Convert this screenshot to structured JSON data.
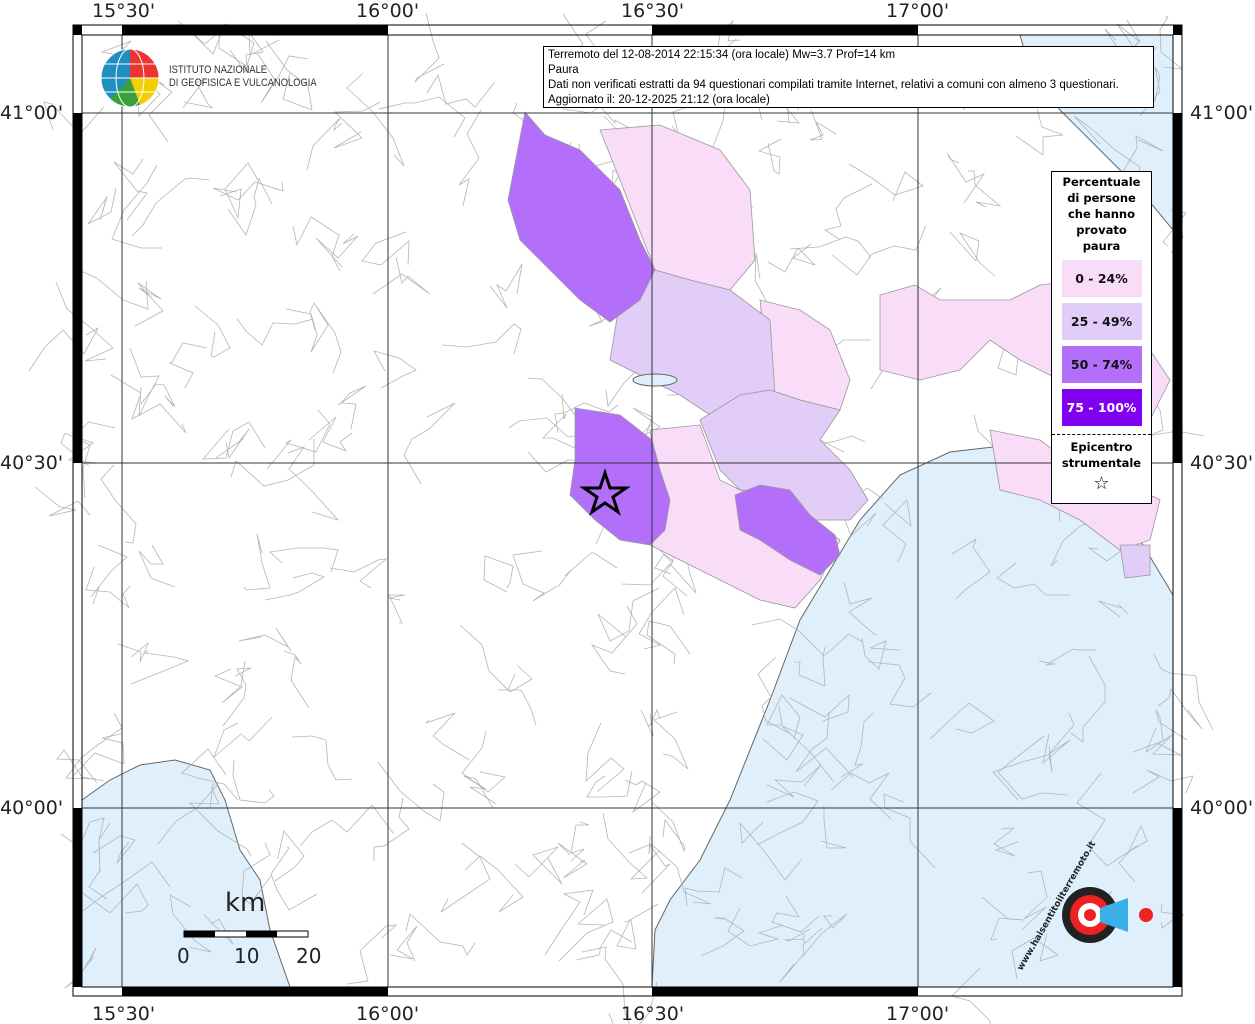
{
  "header": {
    "title_line": "Terremoto del 12-08-2014 22:15:34 (ora locale) Mw=3.7 Prof=14 km",
    "parameter": "Paura",
    "note": "Dati non verificati estratti da 94 questionari compilati tramite Internet, relativi a comuni con almeno 3 questionari.",
    "updated": "Aggiornato il: 20-12-2025 21:12 (ora locale)"
  },
  "logo": {
    "line1": "ISTITUTO NAZIONALE",
    "line2": "DI GEOFISICA E VULCANOLOGIA"
  },
  "brand": "www.haisentitoilterremoto.it",
  "axes": {
    "lon_labels": [
      "15°30'",
      "16°00'",
      "16°30'",
      "17°00'"
    ],
    "lat_labels": [
      "41°00'",
      "40°30'",
      "40°00'"
    ]
  },
  "legend": {
    "title": [
      "Percentuale",
      "di persone",
      "che hanno",
      "provato",
      "paura"
    ],
    "classes": [
      {
        "label": "0 - 24%",
        "color": "#f8dcf8",
        "text_color": "#111"
      },
      {
        "label": "25 - 49%",
        "color": "#e2ccf8",
        "text_color": "#111"
      },
      {
        "label": "50 - 74%",
        "color": "#b46ffa",
        "text_color": "#111"
      },
      {
        "label": "75 - 100%",
        "color": "#8000f0",
        "text_color": "#fff"
      }
    ],
    "epicenter_label": [
      "Epicentro",
      "strumentale"
    ],
    "epicenter_symbol": "☆"
  },
  "scale": {
    "unit": "km",
    "ticks": [
      "0",
      "10",
      "20"
    ]
  },
  "colors": {
    "sea": "#dff0fc",
    "land": "#ffffff",
    "grid": "#333333",
    "borders": "#aaaaaa"
  }
}
